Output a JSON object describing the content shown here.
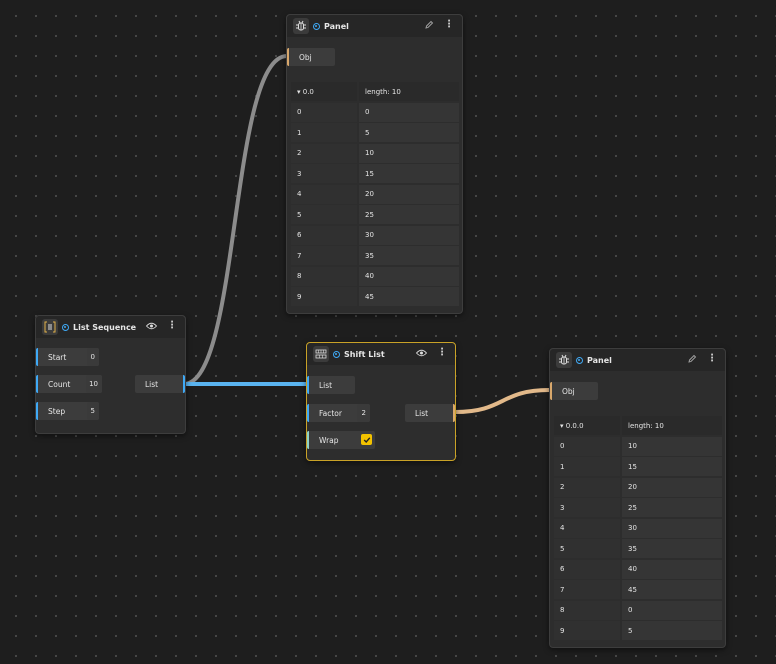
{
  "panel_top": {
    "title": "Panel",
    "input_label": "Obj",
    "path_label": "▾ 0.0",
    "length_label": "length: 10",
    "rows": [
      {
        "i": "0",
        "v": "0"
      },
      {
        "i": "1",
        "v": "5"
      },
      {
        "i": "2",
        "v": "10"
      },
      {
        "i": "3",
        "v": "15"
      },
      {
        "i": "4",
        "v": "20"
      },
      {
        "i": "5",
        "v": "25"
      },
      {
        "i": "6",
        "v": "30"
      },
      {
        "i": "7",
        "v": "35"
      },
      {
        "i": "8",
        "v": "40"
      },
      {
        "i": "9",
        "v": "45"
      }
    ]
  },
  "list_sequence": {
    "title": "List Sequence",
    "inputs": [
      {
        "label": "Start",
        "value": "0"
      },
      {
        "label": "Count",
        "value": "10"
      },
      {
        "label": "Step",
        "value": "5"
      }
    ],
    "output_label": "List"
  },
  "shift_list": {
    "title": "Shift List",
    "inputs": {
      "list": "List",
      "factor": "Factor",
      "factor_value": "2",
      "wrap": "Wrap"
    },
    "output_label": "List"
  },
  "panel_right": {
    "title": "Panel",
    "input_label": "Obj",
    "path_label": "▾ 0.0.0",
    "length_label": "length: 10",
    "rows": [
      {
        "i": "0",
        "v": "10"
      },
      {
        "i": "1",
        "v": "15"
      },
      {
        "i": "2",
        "v": "20"
      },
      {
        "i": "3",
        "v": "25"
      },
      {
        "i": "4",
        "v": "30"
      },
      {
        "i": "5",
        "v": "35"
      },
      {
        "i": "6",
        "v": "40"
      },
      {
        "i": "7",
        "v": "45"
      },
      {
        "i": "8",
        "v": "0"
      },
      {
        "i": "9",
        "v": "5"
      }
    ]
  },
  "colors": {
    "wire_list": "#5ab4f0",
    "wire_panel": "#8c8c8c",
    "wire_shift": "#e2b98a",
    "accent": "#3fa9f5",
    "selection": "#c9a227",
    "wrap_check": "#f2c200"
  }
}
